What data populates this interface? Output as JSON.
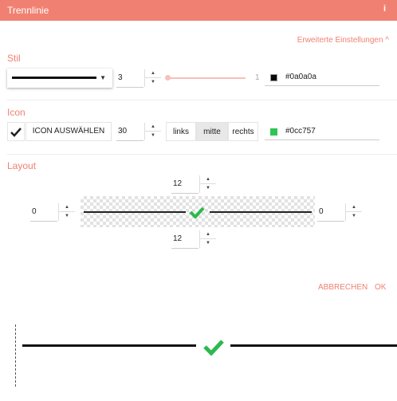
{
  "dialog": {
    "title": "Trennlinie",
    "info_icon": "i"
  },
  "advanced_link": "Erweiterte Einstellungen ^",
  "style_section": {
    "label": "Stil",
    "line_style": "solid",
    "width_value": "3",
    "slider_max": "1",
    "slider_value": 0,
    "color_hex": "#0a0a0a",
    "color": "#0a0a0a"
  },
  "icon_section": {
    "label": "Icon",
    "choose_label": "ICON AUSWÄHLEN",
    "size_value": "30",
    "align_buttons": [
      {
        "label": "links",
        "active": false
      },
      {
        "label": "mitte",
        "active": true
      },
      {
        "label": "rechts",
        "active": false
      }
    ],
    "color_hex": "#0cc757",
    "color": "#0cc757"
  },
  "layout_section": {
    "label": "Layout",
    "top_value": "12",
    "left_value": "0",
    "right_value": "0",
    "bottom_value": "12"
  },
  "actions": {
    "cancel": "ABBRECHEN",
    "ok": "OK"
  },
  "colors": {
    "accent": "#f08172",
    "check": "#2eb84d"
  }
}
